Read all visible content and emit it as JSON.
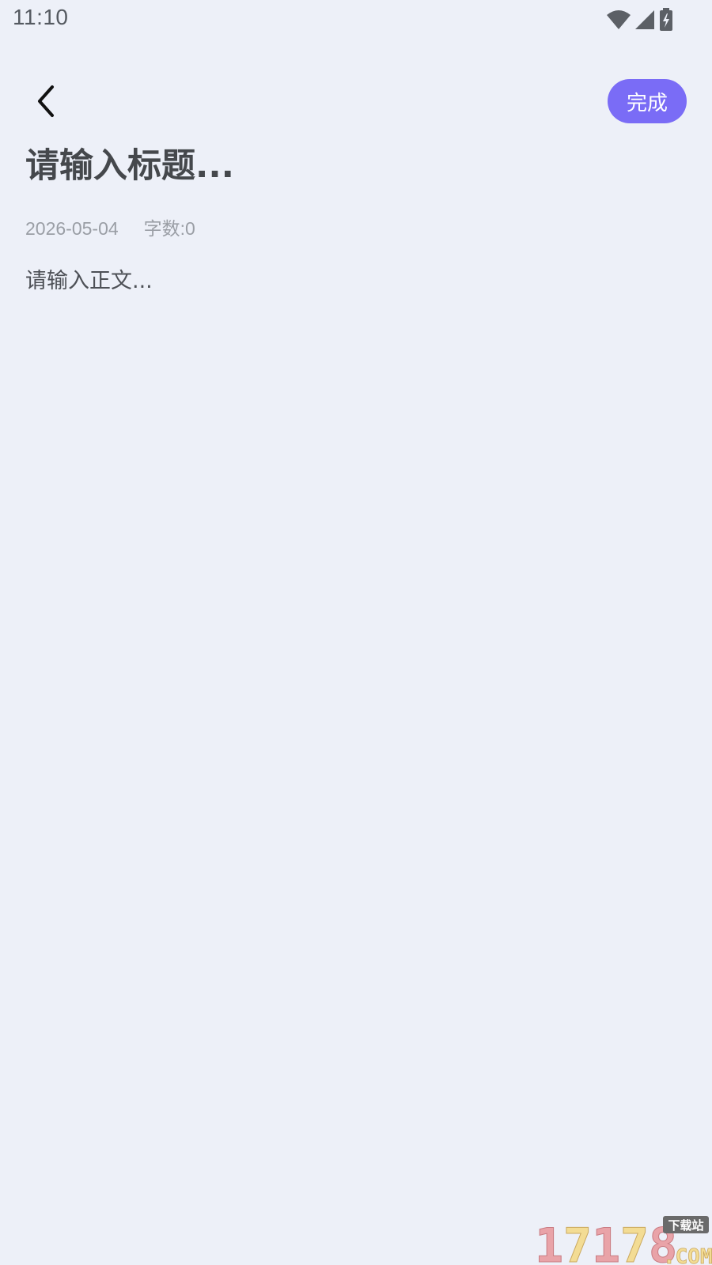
{
  "status_bar": {
    "time": "11:10",
    "icons": [
      "wifi-icon",
      "cellular-signal-icon",
      "battery-charging-icon"
    ]
  },
  "toolbar": {
    "back_icon": "chevron-left-icon",
    "done_label": "完成",
    "done_color": "#7a6cf6"
  },
  "note": {
    "title_placeholder": "请输入标题...",
    "date": "2026-05-04",
    "word_count": "字数:0",
    "body_placeholder": "请输入正文..."
  },
  "watermark": {
    "text": "17178.COM",
    "tag": "下载站"
  },
  "colors": {
    "background": "#edf0f8",
    "accent": "#7a6cf6",
    "title_text": "#45484c",
    "meta_text": "#9a9ea5"
  }
}
